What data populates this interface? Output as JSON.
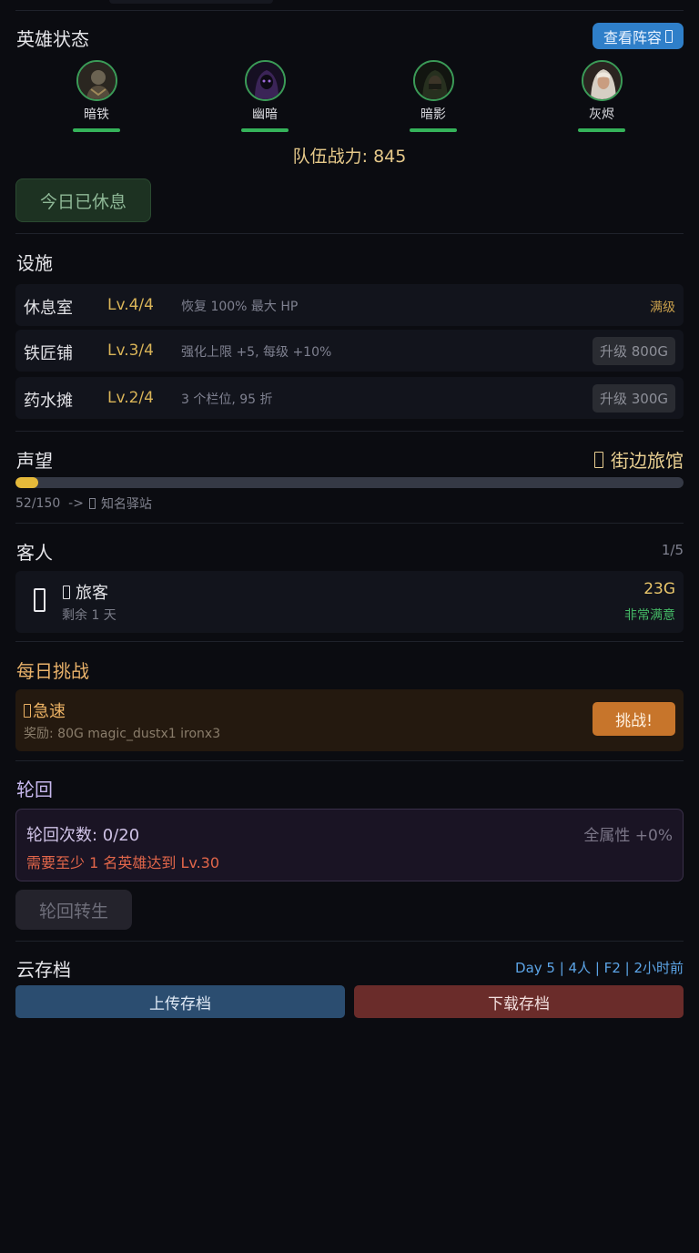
{
  "heroes_section": {
    "title": "英雄状态",
    "view_team_label": "查看阵容",
    "heroes": [
      {
        "name": "暗铁",
        "hp_fraction": 1.0,
        "icon": "armored-warrior-portrait"
      },
      {
        "name": "幽暗",
        "hp_fraction": 1.0,
        "icon": "purple-hooded-mage-portrait"
      },
      {
        "name": "暗影",
        "hp_fraction": 1.0,
        "icon": "green-hooded-rogue-portrait"
      },
      {
        "name": "灰烬",
        "hp_fraction": 1.0,
        "icon": "white-hooded-priestess-portrait"
      }
    ],
    "team_power": "队伍战力: 845",
    "rest_button_label": "今日已休息"
  },
  "facilities_section": {
    "title": "设施",
    "rows": [
      {
        "name": "休息室",
        "level": "Lv.4/4",
        "desc": "恢复 100% 最大 HP",
        "status": "满级"
      },
      {
        "name": "铁匠铺",
        "level": "Lv.3/4",
        "desc": "强化上限 +5, 每级 +10%",
        "upgrade": "升级 800G"
      },
      {
        "name": "药水摊",
        "level": "Lv.2/4",
        "desc": "3 个栏位, 95 折",
        "upgrade": "升级 300G"
      }
    ]
  },
  "reputation_section": {
    "title": "声望",
    "rank": "街边旅馆",
    "progress": 0.0347,
    "progress_text": "52/150  ->",
    "next_rank": "知名驿站"
  },
  "guests_section": {
    "title": "客人",
    "count": "1/5",
    "guests": [
      {
        "name": "旅客",
        "remaining": "剩余 1 天",
        "payment": "23G",
        "mood": "非常满意"
      }
    ]
  },
  "challenge_section": {
    "title": "每日挑战",
    "name": "急速",
    "reward": "奖励: 80G magic_dustx1 ironx3",
    "button_label": "挑战!"
  },
  "reincarnation_section": {
    "title": "轮回",
    "count": "轮回次数: 0/20",
    "bonus": "全属性 +0%",
    "requirement": "需要至少 1 名英雄达到 Lv.30",
    "button_label": "轮回转生"
  },
  "cloud_section": {
    "title": "云存档",
    "meta": "Day 5 | 4人 | F2 | 2小时前",
    "upload_label": "上传存档",
    "download_label": "下载存档"
  },
  "colors": {
    "background": "#0b0c11",
    "accent_blue": "#2f7fc9",
    "gold": "#d9b458",
    "hp_green": "#35b35a",
    "challenge_orange": "#c7752b",
    "warning_red": "#e2664a"
  }
}
